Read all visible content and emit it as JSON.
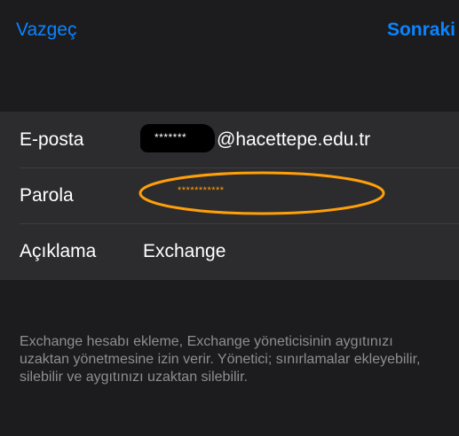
{
  "nav": {
    "cancel_label": "Vazgeç",
    "next_label": "Sonraki"
  },
  "form": {
    "email": {
      "label": "E-posta",
      "redacted_text": "*******",
      "domain_text": "@hacettepe.edu.tr"
    },
    "password": {
      "label": "Parola",
      "value": "***********"
    },
    "description": {
      "label": "Açıklama",
      "value": "Exchange"
    }
  },
  "footer": {
    "text": "Exchange hesabı ekleme, Exchange yöneticisinin aygıtınızı uzaktan yönetmesine izin verir. Yönetici; sınırlamalar ekleyebilir, silebilir ve aygıtınızı uzaktan silebilir."
  },
  "colors": {
    "background": "#1c1c1e",
    "group_background": "#2c2c2e",
    "accent_blue": "#0a84ff",
    "highlight_orange": "#ff9f0a",
    "secondary_text": "#8e8e93"
  }
}
